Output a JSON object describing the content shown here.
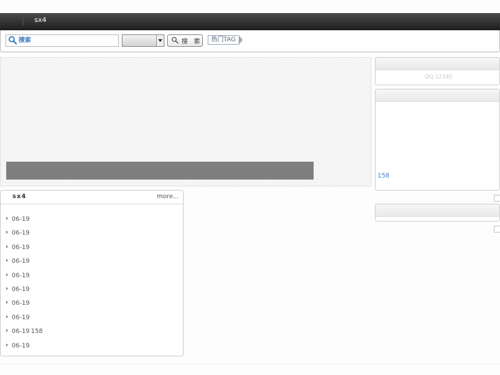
{
  "topbar": {
    "site_name": "sx4"
  },
  "search": {
    "placeholder": "搜索",
    "category_selected": "",
    "button_label": "搜 索",
    "hot_tag_label": "热门TAG"
  },
  "sidebar": {
    "contact_text": "QQ 12345",
    "box2_count": "158"
  },
  "news": {
    "title": "sx4",
    "more_label": "more...",
    "items": [
      {
        "date": "06-19",
        "extra": ""
      },
      {
        "date": "06-19",
        "extra": ""
      },
      {
        "date": "06-19",
        "extra": ""
      },
      {
        "date": "06-19",
        "extra": ""
      },
      {
        "date": "06-19",
        "extra": ""
      },
      {
        "date": "06-19",
        "extra": ""
      },
      {
        "date": "06-19",
        "extra": ""
      },
      {
        "date": "06-19",
        "extra": ""
      },
      {
        "date": "06-19",
        "extra": "158"
      },
      {
        "date": "06-19",
        "extra": ""
      }
    ]
  },
  "icons": {
    "search_input": "search-icon",
    "search_button": "search-icon",
    "select_arrow": "caret-down-icon",
    "list_bullet": "chevron-right-icon"
  }
}
